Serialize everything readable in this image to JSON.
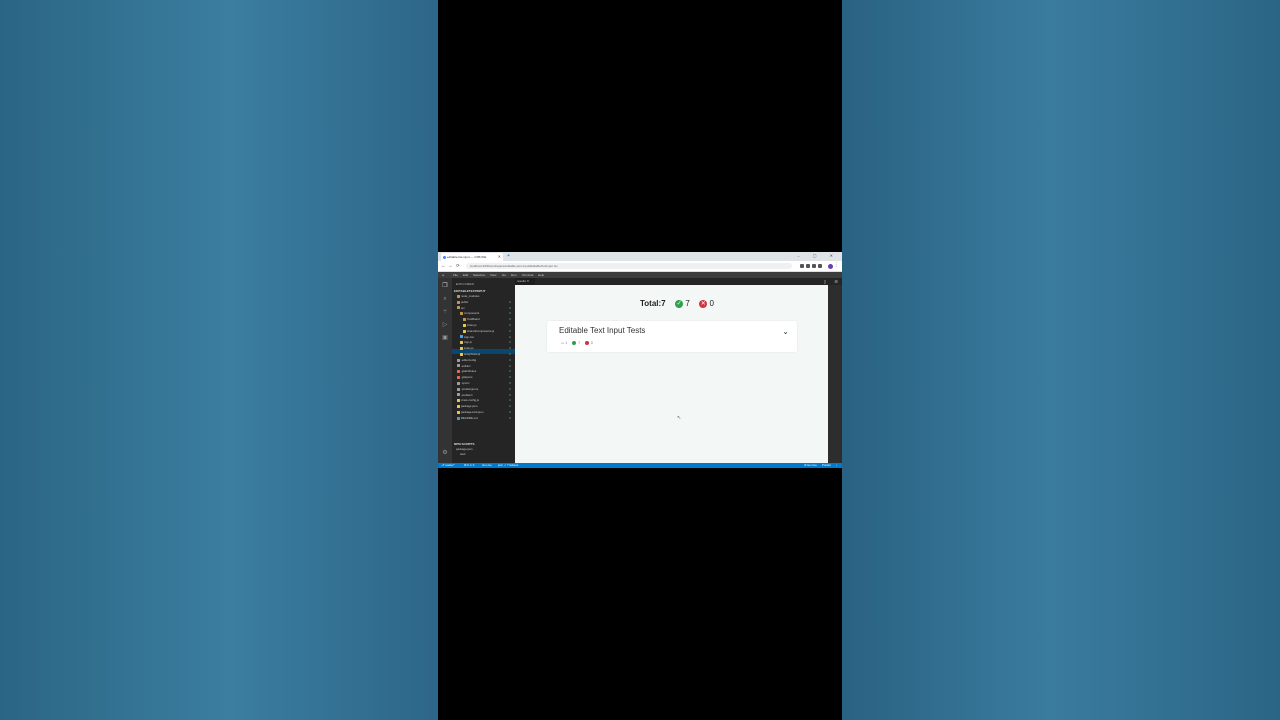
{
  "browser": {
    "tab_title": "editable-list-input — CSB IDE",
    "new_tab": "+",
    "window_controls": "– ▢ ✕",
    "url": "localhost:3000/workspace/editable-text-input/EditableTextInput.tsx"
  },
  "vscode": {
    "menu": [
      "File",
      "Edit",
      "Selection",
      "View",
      "Go",
      "Run",
      "Terminal",
      "Help"
    ],
    "explorer_title": "EXPLORER",
    "project_name": "EDITABLETEXTINPUT",
    "tree": [
      {
        "label": "node_modules",
        "kind": "folder",
        "indent": 1
      },
      {
        "label": "public",
        "kind": "folder",
        "indent": 1,
        "mark": "U"
      },
      {
        "label": "src",
        "kind": "folder",
        "indent": 1,
        "mark": "U"
      },
      {
        "label": "components",
        "kind": "folder",
        "indent": 2,
        "mark": "U"
      },
      {
        "label": "TestBoard",
        "kind": "folder",
        "indent": 3,
        "mark": "U"
      },
      {
        "label": "index.js",
        "kind": "js",
        "indent": 3,
        "mark": "U"
      },
      {
        "label": "sharedComponents.js",
        "kind": "js",
        "indent": 3,
        "mark": "U"
      },
      {
        "label": "App.css",
        "kind": "css",
        "indent": 2,
        "mark": "U"
      },
      {
        "label": "App.js",
        "kind": "js",
        "indent": 2,
        "mark": "U"
      },
      {
        "label": "index.js",
        "kind": "js",
        "indent": 2,
        "mark": "U"
      },
      {
        "label": "setupTests.js",
        "kind": "js",
        "indent": 2,
        "mark": "U"
      },
      {
        "label": ".editorconfig",
        "kind": "cfg",
        "indent": 1,
        "mark": "U"
      },
      {
        "label": ".eslintrc",
        "kind": "cfg",
        "indent": 1,
        "mark": "U"
      },
      {
        "label": ".gitattributes",
        "kind": "git",
        "indent": 1,
        "mark": "U"
      },
      {
        "label": ".gitignore",
        "kind": "git",
        "indent": 1,
        "mark": "U"
      },
      {
        "label": ".npmrc",
        "kind": "cfg",
        "indent": 1,
        "mark": "U"
      },
      {
        "label": ".prettierignore",
        "kind": "cfg",
        "indent": 1,
        "mark": "U"
      },
      {
        "label": ".prettierrc",
        "kind": "cfg",
        "indent": 1,
        "mark": "U"
      },
      {
        "label": "craco.config.js",
        "kind": "js",
        "indent": 1,
        "mark": "U"
      },
      {
        "label": "package.json",
        "kind": "json",
        "indent": 1,
        "mark": "U"
      },
      {
        "label": "package-lock.json",
        "kind": "json",
        "indent": 1,
        "mark": "U"
      },
      {
        "label": "README.md",
        "kind": "md",
        "indent": 1,
        "mark": "U"
      }
    ],
    "npm_scripts_title": "NPM SCRIPTS",
    "npm_items": [
      "package.json",
      "start"
    ],
    "editor_tab": "results ✕",
    "status_left": [
      "⎇ master*",
      "⊗ 0 ⚠ 0",
      "Go Live",
      "jest: ✓ 7 failures"
    ],
    "status_right": [
      "⊘ Go Live",
      "Prettier"
    ]
  },
  "preview": {
    "total_label": "Total:7",
    "passed_count": "7",
    "failed_count": "0",
    "suite_title": "Editable Text Input Tests",
    "suite_comments": "1",
    "suite_passed": "7",
    "suite_failed": "0"
  },
  "colors": {
    "pass": "#2f9e4f",
    "fail": "#d0343c",
    "statusbar": "#007acc",
    "background": "#2b6584"
  }
}
